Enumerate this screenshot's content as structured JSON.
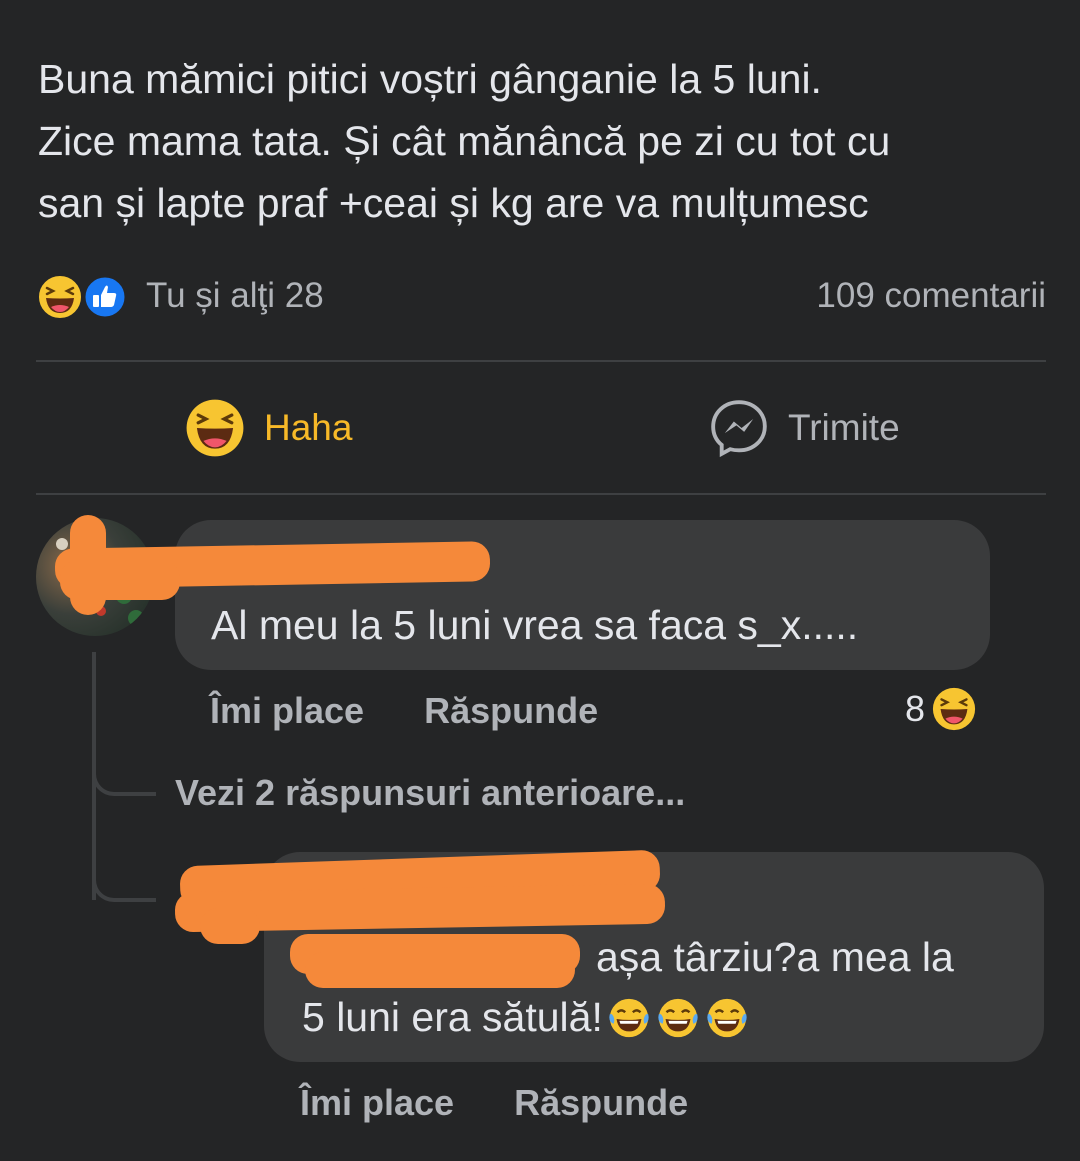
{
  "post": {
    "lines": [
      "Buna mămici pitici voștri gânganie la 5 luni.",
      "Zice mama tata. Și cât mănâncă pe zi cu tot cu",
      "san și lapte praf +ceai și kg are  va mulțumesc"
    ],
    "reactions_text": "Tu și alţi 28",
    "comments_count": "109 comentarii"
  },
  "actions": {
    "haha_label": "Haha",
    "send_label": "Trimite"
  },
  "comments": [
    {
      "text": "Al meu la 5 luni vrea sa faca s_x.....",
      "like_label": "Îmi place",
      "reply_label": "Răspunde",
      "reaction_count": "8"
    }
  ],
  "see_more_replies": "Vezi 2 răspunsuri anterioare...",
  "reply": {
    "line1": "așa târziu?a mea la",
    "line2": "5 luni era sătulă!",
    "like_label": "Îmi place",
    "reply_label": "Răspunde"
  },
  "colors": {
    "background": "#242526",
    "bubble": "#3a3b3c",
    "haha_yellow": "#f7b928",
    "like_blue": "#1877f2",
    "redaction_orange": "#f5893a"
  },
  "icons": {
    "reaction_1": "haha-emoji-icon",
    "reaction_2": "like-thumb-icon",
    "haha_action": "haha-emoji-icon",
    "send_action": "messenger-icon",
    "reply_emojis": "crying-laughing-emoji-icon"
  }
}
